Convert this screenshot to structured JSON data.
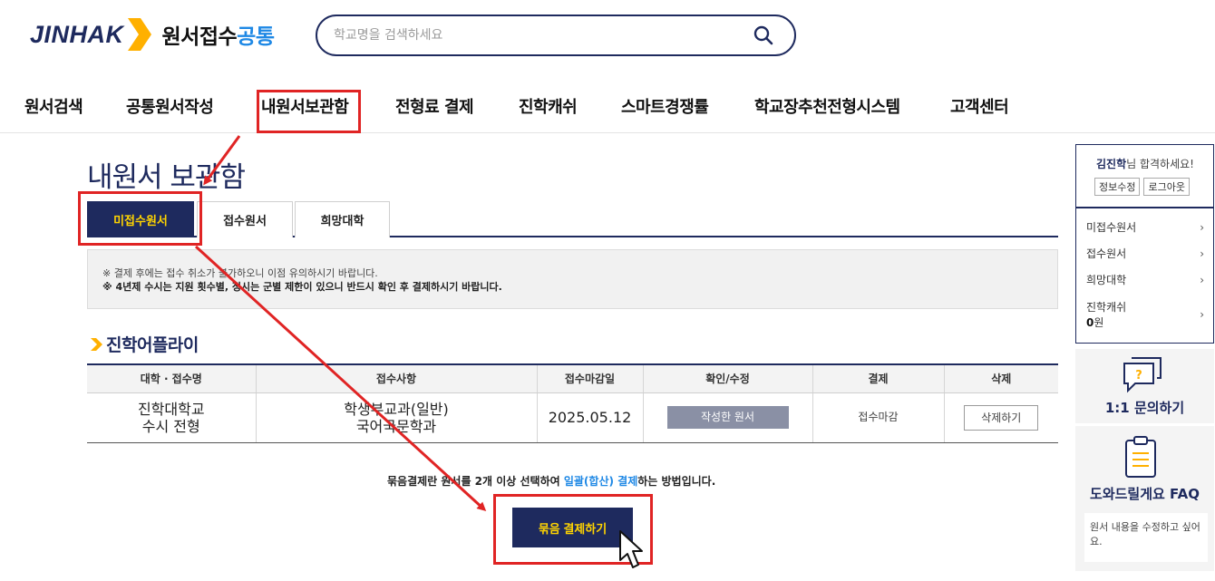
{
  "header": {
    "logo_text": "JINHAK",
    "logo_sub_main": "원서접수",
    "logo_sub_accent": "공통",
    "search_placeholder": "학교명을 검색하세요"
  },
  "nav": {
    "items": [
      "원서검색",
      "공통원서작성",
      "내원서보관함",
      "전형료 결제",
      "진학캐쉬",
      "스마트경쟁률",
      "학교장추천전형시스템",
      "고객센터"
    ]
  },
  "page": {
    "title": "내원서 보관함",
    "tabs": [
      "미접수원서",
      "접수원서",
      "희망대학"
    ],
    "notice_line1": "※ 결제 후에는 접수 취소가 불가하오니 이점 유의하시기 바랍니다.",
    "notice_line2": "※ 4년제 수시는 지원 횟수별, 정시는 군별 제한이 있으니 반드시 확인 후 결제하시기 바랍니다.",
    "section_title": "진학어플라이"
  },
  "table": {
    "headers": [
      "대학 · 접수명",
      "접수사항",
      "접수마감일",
      "확인/수정",
      "결제",
      "삭제"
    ],
    "row": {
      "univ_line1": "진학대학교",
      "univ_line2": "수시 전형",
      "detail_line1": "학생부교과(일반)",
      "detail_line2": "국어국문학과",
      "deadline": "2025.05.12",
      "confirm_btn": "작성한 원서",
      "payment": "접수마감",
      "delete_btn": "삭제하기"
    }
  },
  "bundle": {
    "msg_pre": "묶음결제란 원서를 2개 이상 선택하여 ",
    "msg_link": "일괄(합산) 결제",
    "msg_post": "하는 방법입니다.",
    "button": "묶음 결제하기"
  },
  "sidebar": {
    "user_name": "김진학",
    "greet_suffix": "님 합격하세요!",
    "edit_btn": "정보수정",
    "logout_btn": "로그아웃",
    "items": [
      "미접수원서",
      "접수원서",
      "희망대학"
    ],
    "cash_label": "진학캐쉬",
    "cash_value": "0",
    "cash_unit": "원",
    "qna_label": "1:1 문의하기",
    "faq_label": "도와드릴게요 FAQ",
    "faq_question": "원서 내용을 수정하고 싶어요."
  },
  "colors": {
    "navy": "#1e2a5e",
    "accent_yellow": "#ffd400",
    "accent_blue": "#1e88e5",
    "annotation_red": "#e02424"
  }
}
